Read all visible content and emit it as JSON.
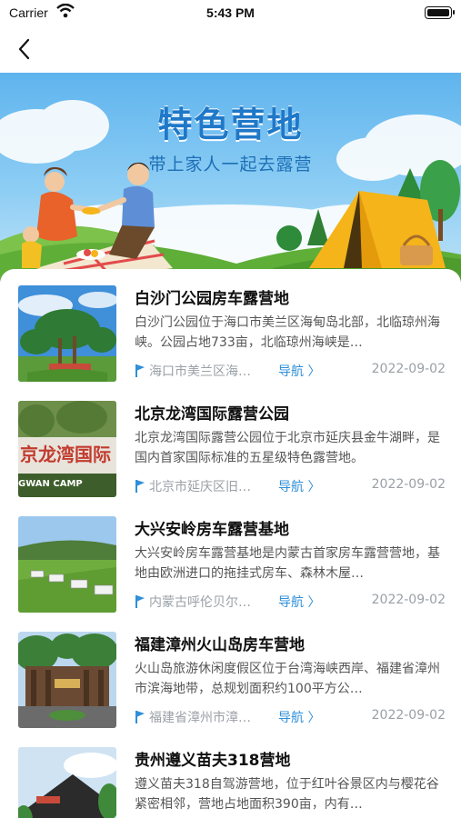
{
  "status": {
    "carrier": "Carrier",
    "time": "5:43 PM"
  },
  "banner": {
    "title": "特色营地",
    "subtitle": "带上家人一起去露营"
  },
  "list": [
    {
      "title": "白沙门公园房车露营地",
      "desc": "白沙门公园位于海口市美兰区海甸岛北部，北临琼州海峡。公园占地733亩，北临琼州海峡是…",
      "location": "海口市美兰区海…",
      "nav": "导航 〉",
      "date": "2022-09-02",
      "thumb": "park-palms"
    },
    {
      "title": "北京龙湾国际露营公园",
      "desc": "北京龙湾国际露营公园位于北京市延庆县金牛湖畔，是国内首家国际标准的五星级特色露营地。",
      "location": "北京市延庆区旧…",
      "nav": "导航 〉",
      "date": "2022-09-02",
      "thumb": "longwan-sign"
    },
    {
      "title": "大兴安岭房车露营基地",
      "desc": "大兴安岭房车露营基地是内蒙古首家房车露营营地，基地由欧洲进口的拖挂式房车、森林木屋…",
      "location": "内蒙古呼伦贝尔…",
      "nav": "导航 〉",
      "date": "2022-09-02",
      "thumb": "rv-field"
    },
    {
      "title": "福建漳州火山岛房车营地",
      "desc": "火山岛旅游休闲度假区位于台湾海峡西岸、福建省漳州市滨海地带，总规划面积约100平方公…",
      "location": "福建省漳州市漳…",
      "nav": "导航 〉",
      "date": "2022-09-02",
      "thumb": "volcano-gate"
    },
    {
      "title": "贵州遵义苗夫318营地",
      "desc": "遵义苗夫318自驾游营地，位于红叶谷景区内与樱花谷紧密相邻，营地占地面积390亩，内有…",
      "location": "",
      "nav": "",
      "date": "",
      "thumb": "cabin"
    }
  ]
}
